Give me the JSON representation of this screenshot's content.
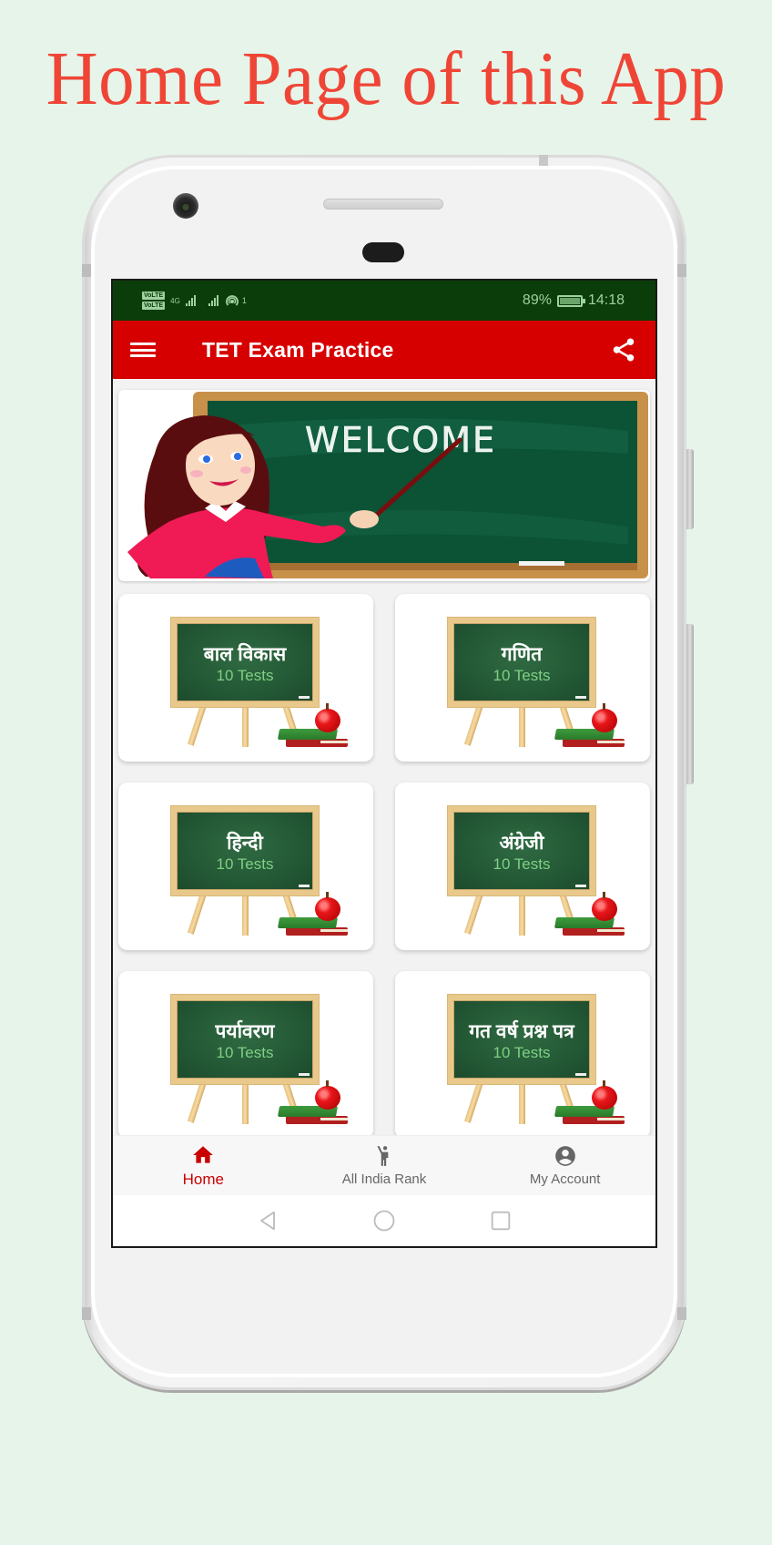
{
  "promo": {
    "title": "Home Page of this App"
  },
  "status_bar": {
    "volte_1": "VoLTE",
    "volte_2": "VoLTE",
    "network": "4G",
    "wifi_badge": "1",
    "battery": "89%",
    "time": "14:18"
  },
  "app_bar": {
    "title": "TET Exam Practice",
    "menu_icon": "hamburger-menu-icon",
    "share_icon": "share-icon"
  },
  "banner": {
    "text": "WELCOME",
    "colors": {
      "board": "#0b5235",
      "frame": "#c8914a"
    }
  },
  "subjects": [
    {
      "name": "बाल विकास",
      "count": "10 Tests"
    },
    {
      "name": "गणित",
      "count": "10 Tests"
    },
    {
      "name": "हिन्दी",
      "count": "10 Tests"
    },
    {
      "name": "अंग्रेजी",
      "count": "10 Tests"
    },
    {
      "name": "पर्यावरण",
      "count": "10 Tests"
    },
    {
      "name": "गत वर्ष प्रश्न पत्र",
      "count": "10 Tests"
    }
  ],
  "bottom_nav": [
    {
      "label": "Home",
      "icon": "home-icon",
      "active": true
    },
    {
      "label": "All India Rank",
      "icon": "person-waving-icon",
      "active": false
    },
    {
      "label": "My Account",
      "icon": "account-circle-icon",
      "active": false
    }
  ],
  "system_nav": {
    "back": "back-icon",
    "home": "home-circle-icon",
    "recents": "recents-icon"
  },
  "colors": {
    "app_bar": "#d70000",
    "status_bar": "#0b3d0a",
    "accent_active": "#c80000",
    "promo_title": "#ef4536",
    "page_background": "#e6f4e9"
  }
}
